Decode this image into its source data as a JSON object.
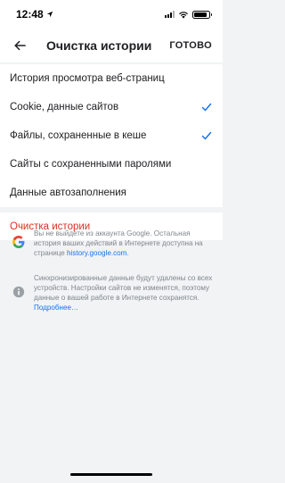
{
  "status_bar": {
    "time": "12:48",
    "location_icon": "location-arrow-icon",
    "signal_icon": "cellular-signal-icon",
    "wifi_icon": "wifi-icon",
    "battery_icon": "battery-icon",
    "battery_level": 0.9
  },
  "toolbar": {
    "back_icon": "back-arrow-icon",
    "title": "Очистка истории",
    "done_label": "ГОТОВО"
  },
  "options": [
    {
      "label": "История просмотра веб-страниц",
      "checked": false
    },
    {
      "label": "Cookie, данные сайтов",
      "checked": true
    },
    {
      "label": "Файлы, сохраненные в кеше",
      "checked": true
    },
    {
      "label": "Сайты с сохраненными паролями",
      "checked": false
    },
    {
      "label": "Данные автозаполнения",
      "checked": false
    }
  ],
  "clear_button": {
    "label": "Очистка истории"
  },
  "google_note": {
    "icon": "google-g-icon",
    "text": "Вы не выйдете из аккаунта Google. Остальная история ваших действий в Интернете доступна на странице ",
    "link": "history.google.com",
    "suffix": "."
  },
  "sync_note": {
    "icon": "info-icon",
    "text": "Синхронизированные данные будут удалены со всех устройств. Настройки сайтов не изменятся, поэтому данные о вашей работе в Интернете сохранятся. ",
    "link": "Подробнее…"
  },
  "colors": {
    "accent": "#1a73e8",
    "danger": "#d93025",
    "background": "#f1f3f4"
  }
}
